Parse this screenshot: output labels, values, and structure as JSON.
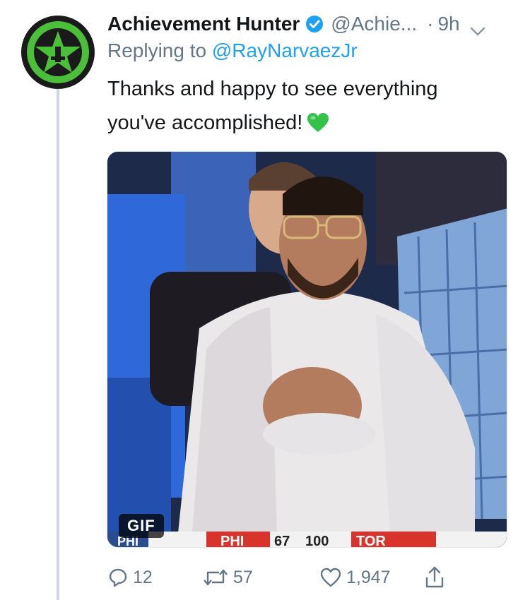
{
  "tweet": {
    "author_name": "Achievement Hunter",
    "author_handle": "@Achie...",
    "separator": "·",
    "time": "9h",
    "verified": true,
    "replying_to_prefix": "Replying to ",
    "replying_to_handle": "@RayNarvaezJr",
    "text_line1": "Thanks and happy to see everything",
    "text_line2": "you've accomplished!",
    "emoji": "green-heart-emoji",
    "media": {
      "type": "gif",
      "badge": "GIF",
      "scoreboard": [
        "PHI",
        "67",
        "100",
        "TOR"
      ]
    }
  },
  "actions": {
    "replies": "12",
    "retweets": "57",
    "likes": "1,947"
  },
  "colors": {
    "accent": "#1da1f2",
    "muted": "#657786",
    "text": "#14171a",
    "thread_line": "#ccd6dd",
    "logo_green": "#4bbf3a"
  }
}
